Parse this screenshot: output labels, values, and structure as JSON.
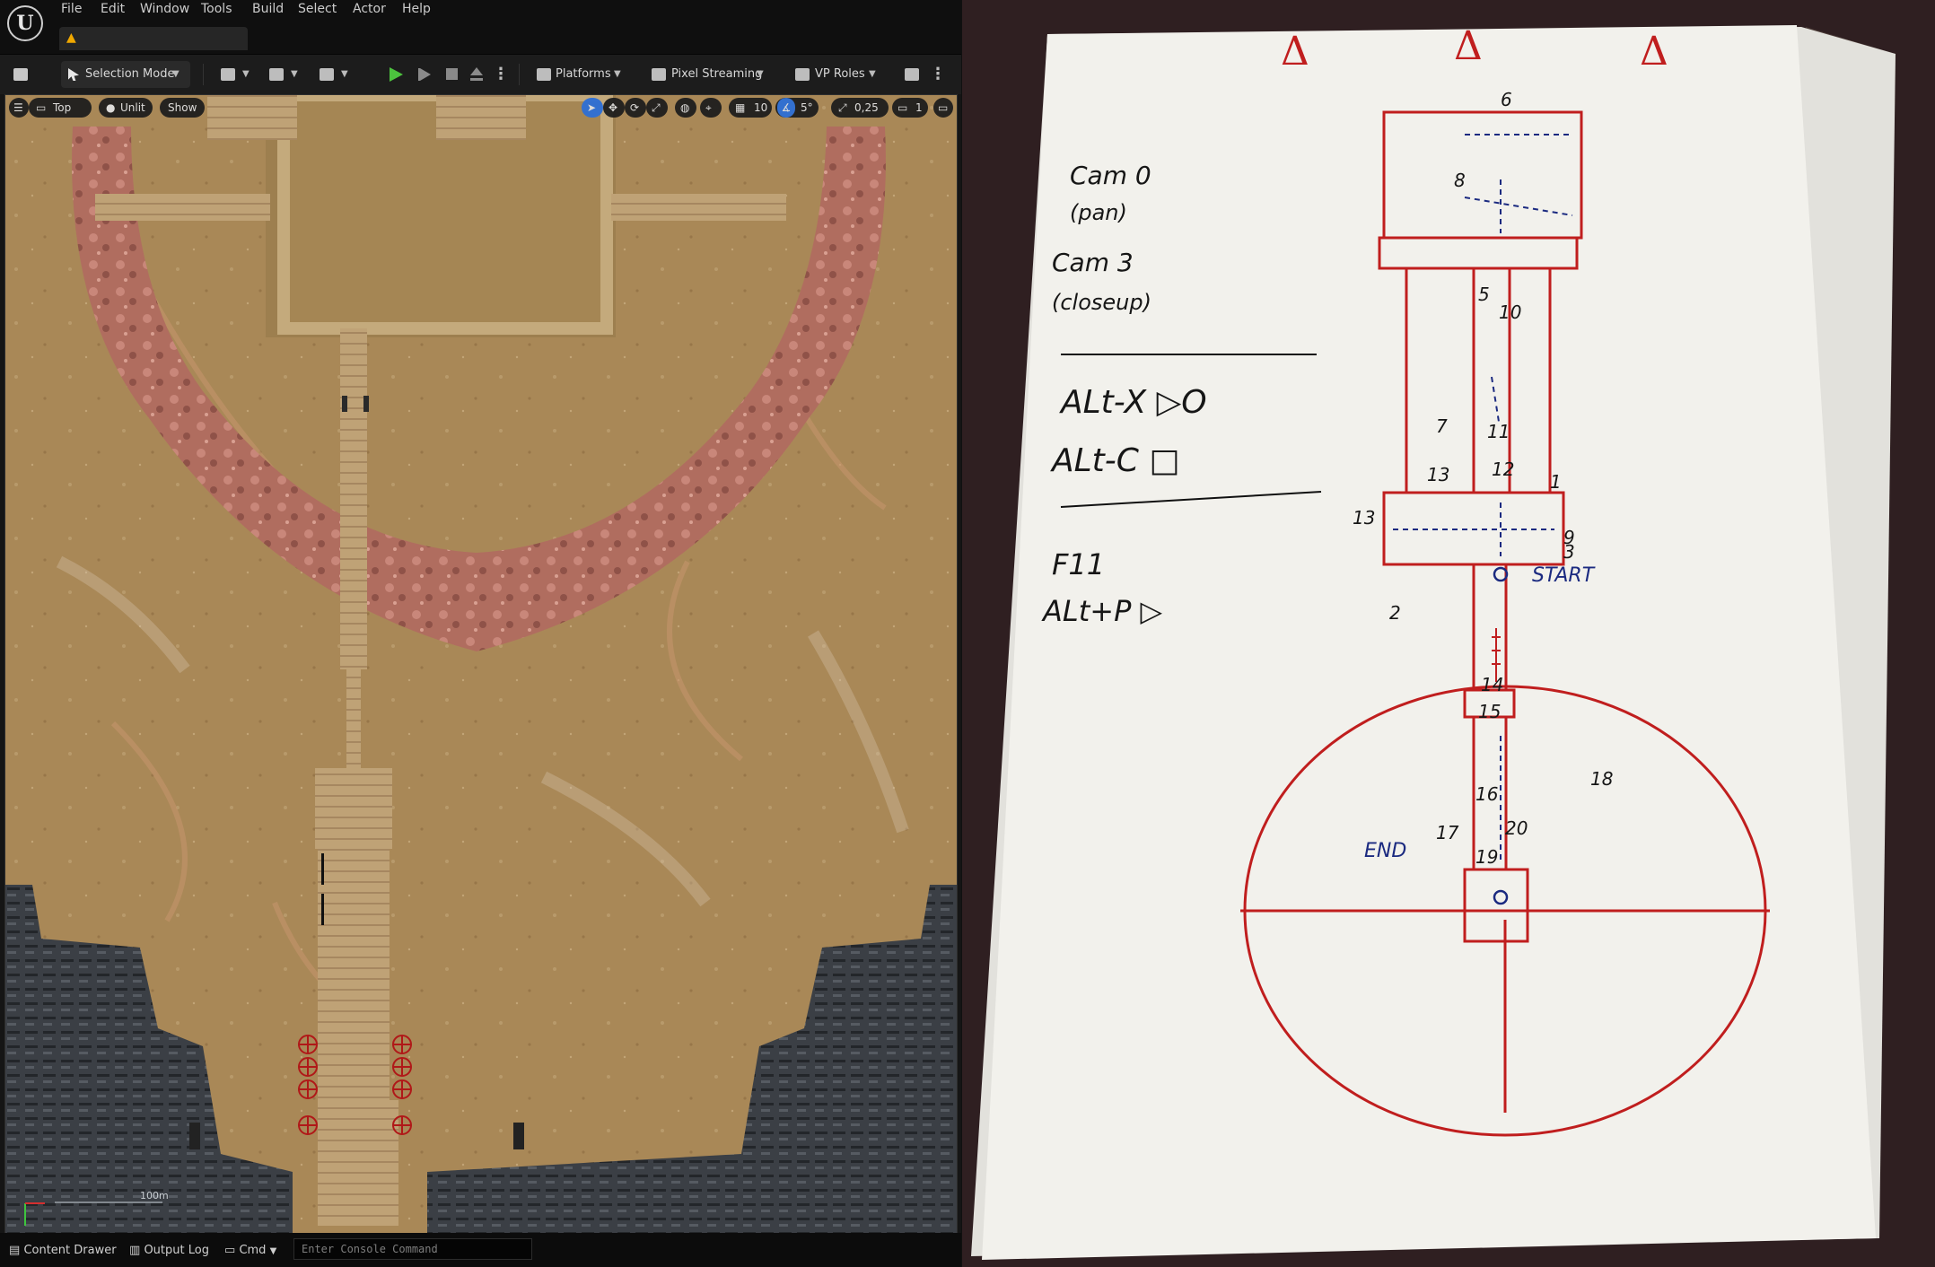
{
  "menu": {
    "items": [
      {
        "id": "file",
        "label": "File"
      },
      {
        "id": "edit",
        "label": "Edit"
      },
      {
        "id": "window",
        "label": "Window"
      },
      {
        "id": "tools",
        "label": "Tools"
      },
      {
        "id": "build",
        "label": "Build"
      },
      {
        "id": "select",
        "label": "Select"
      },
      {
        "id": "actor",
        "label": "Actor"
      },
      {
        "id": "help",
        "label": "Help"
      }
    ]
  },
  "toolbar": {
    "mode_label": "Selection Mode",
    "platforms_label": "Platforms",
    "pixel_streaming_label": "Pixel Streaming",
    "vp_roles_label": "VP Roles"
  },
  "viewport": {
    "view_label": "Top",
    "lit_label": "Unlit",
    "show_label": "Show",
    "grid_snap": "10",
    "rotation_snap": "5°",
    "scale_snap": "0,25",
    "camera_speed": "1",
    "scale_bar": "100m",
    "accent_color": "#2d6fd6"
  },
  "statusbar": {
    "content_drawer": "Content Drawer",
    "output_log": "Output Log",
    "cmd": "Cmd",
    "console_placeholder": "Enter Console Command"
  },
  "sketch": {
    "arrows_top": [
      "Δ",
      "Δ",
      "Δ"
    ],
    "notes": {
      "cam0": "Cam 0",
      "pan": "(pan)",
      "cam3": "Cam 3",
      "closeup": "(closeup)",
      "alt_x": "ALt-X ▷O",
      "alt_c": "ALt-C □",
      "f11": "F11",
      "alt_p": "ALt+P ▷"
    },
    "start_label": "START",
    "end_label": "END",
    "numbers": {
      "n6": "6",
      "n8": "8",
      "n5": "5",
      "n10": "10",
      "n7": "7",
      "n11": "11",
      "n13a": "13",
      "n12": "12",
      "n1": "1",
      "n13": "13",
      "n9": "9",
      "n3": "3",
      "n2": "2",
      "n14": "14",
      "n15": "15",
      "n18": "18",
      "n16": "16",
      "n20": "20",
      "n17": "17",
      "n19": "19"
    }
  }
}
